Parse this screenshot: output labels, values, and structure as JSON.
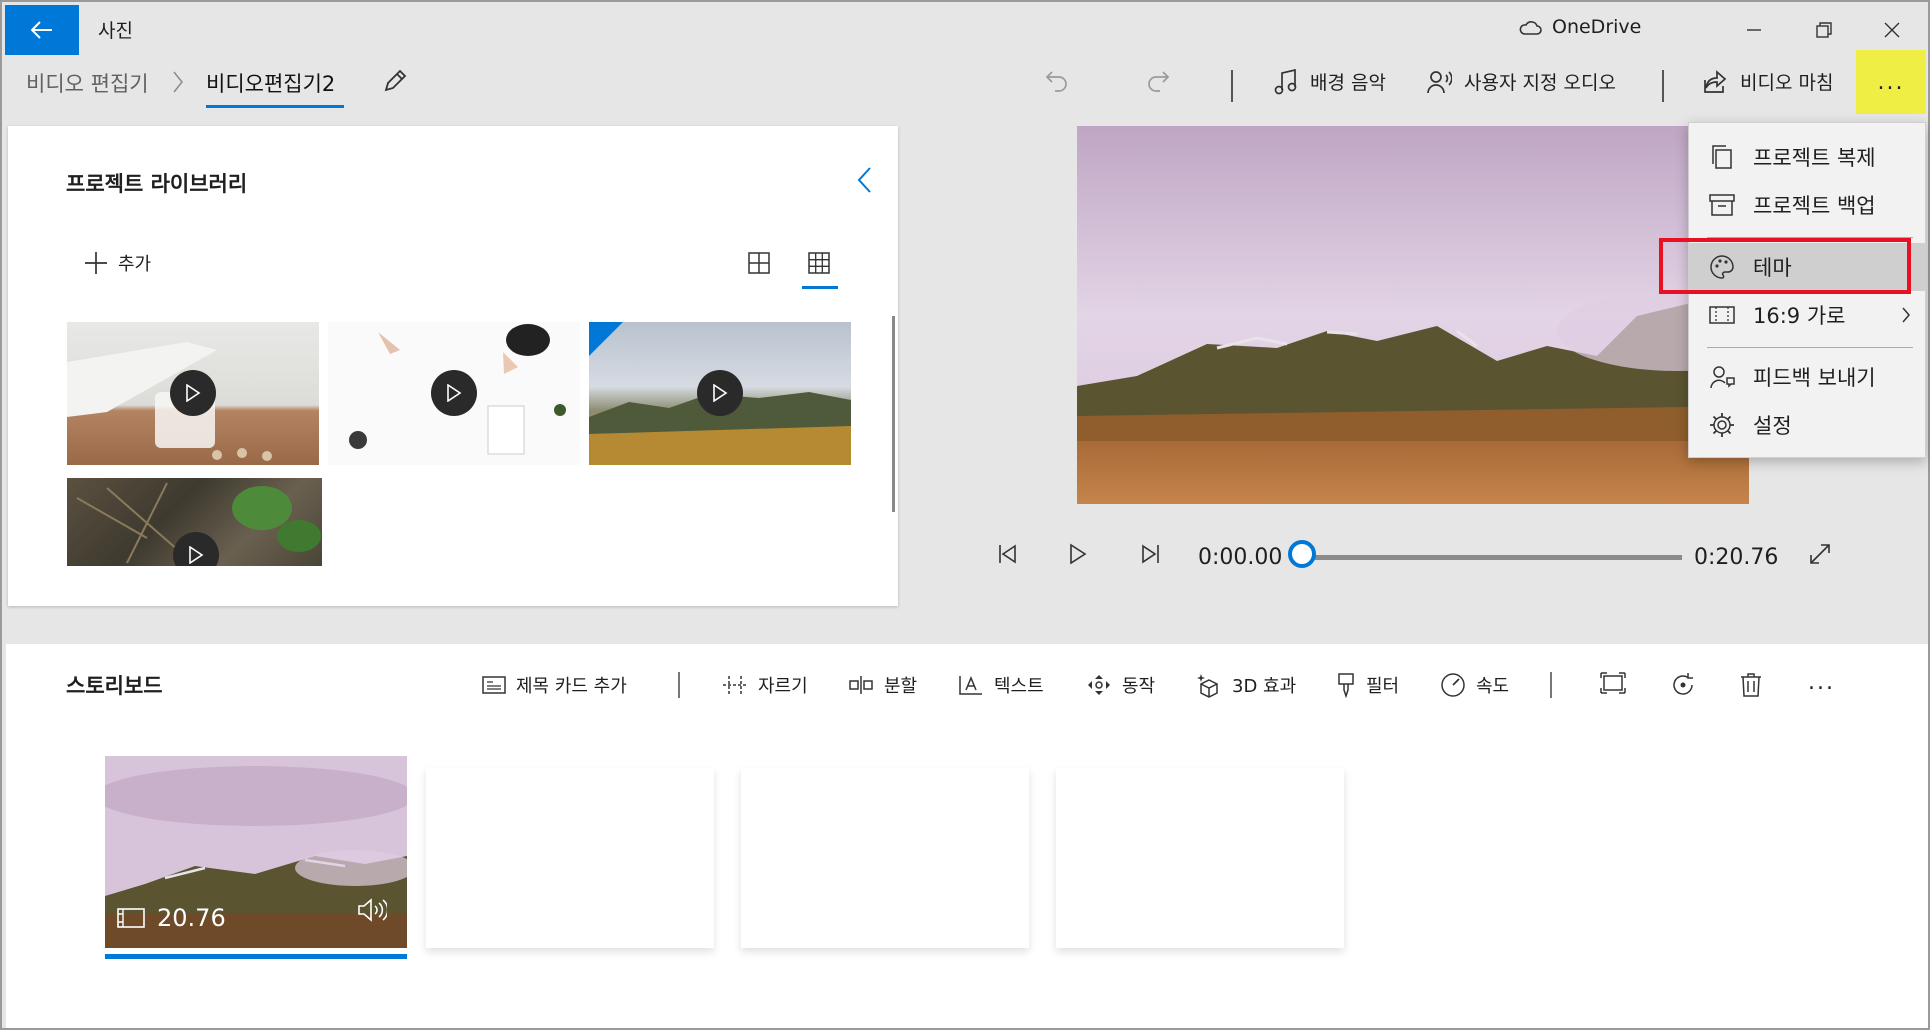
{
  "window": {
    "app_title": "사진",
    "onedrive_label": "OneDrive"
  },
  "header": {
    "breadcrumb_root": "비디오 편집기",
    "breadcrumb_separator": ">",
    "project_name": "비디오편집기2",
    "background_music": "배경 음악",
    "custom_audio": "사용자 지정 오디오",
    "finish_video": "비디오 마침",
    "more_label": "..."
  },
  "library": {
    "title": "프로젝트 라이브러리",
    "add_label": "추가"
  },
  "player": {
    "current_time": "0:00.00",
    "total_time": "0:20.76",
    "progress": 0
  },
  "storyboard": {
    "title": "스토리보드",
    "tools": {
      "title_card": "제목 카드 추가",
      "trim": "자르기",
      "split": "분할",
      "text": "텍스트",
      "motion": "동작",
      "effects_3d": "3D 효과",
      "filter": "필터",
      "speed": "속도",
      "more": "..."
    },
    "clip": {
      "duration": "20.76"
    }
  },
  "menu": {
    "items": [
      {
        "label": "프로젝트 복제",
        "icon": "copy-icon"
      },
      {
        "label": "프로젝트 백업",
        "icon": "archive-icon"
      },
      {
        "label": "테마",
        "icon": "palette-icon"
      },
      {
        "label": "16:9 가로",
        "icon": "aspect-ratio-icon"
      },
      {
        "label": "피드백 보내기",
        "icon": "feedback-icon"
      },
      {
        "label": "설정",
        "icon": "gear-icon"
      }
    ]
  },
  "colors": {
    "accent": "#0078d7",
    "highlight_yellow": "#eeee44",
    "annotation_red": "#e81123"
  }
}
